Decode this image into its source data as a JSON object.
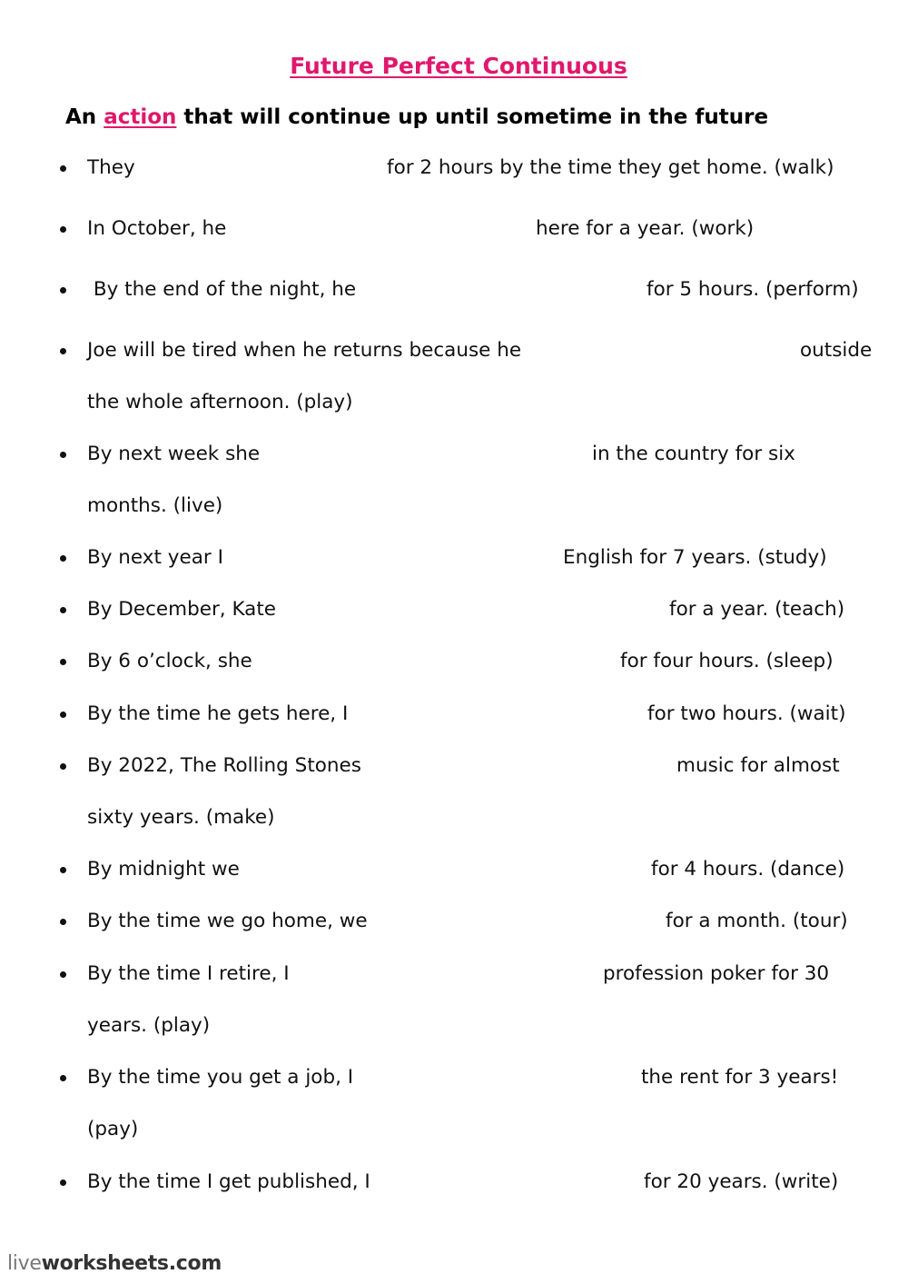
{
  "title": "Future Perfect Continuous",
  "subtitle": {
    "pre": "An ",
    "highlight": "action",
    "post": " that will continue up until sometime in the future"
  },
  "colors": {
    "accent": "#e0186c",
    "text": "#111111"
  },
  "items": [
    {
      "before": "They",
      "after": "for 2 hours by the time they get home. (walk)",
      "cont": ""
    },
    {
      "before": "In October, he",
      "after": "here for a year. (work)",
      "cont": ""
    },
    {
      "before": " By the end of the night, he",
      "after": "for 5 hours. (perform)",
      "cont": ""
    },
    {
      "before": "Joe will be tired when he returns because he",
      "after": "outside",
      "cont": "the whole afternoon. (play)"
    },
    {
      "before": "By next week she",
      "after": "in the country for six",
      "cont": "months. (live)"
    },
    {
      "before": "By next year I",
      "after": "English for 7 years. (study)",
      "cont": ""
    },
    {
      "before": "By December, Kate",
      "after": "for a year. (teach)",
      "cont": ""
    },
    {
      "before": "By 6 o’clock, she",
      "after": "for four hours. (sleep)",
      "cont": ""
    },
    {
      "before": "By the time he gets here, I",
      "after": "for two hours. (wait)",
      "cont": ""
    },
    {
      "before": "By 2022, The Rolling Stones",
      "after": "music for almost",
      "cont": "sixty years. (make)"
    },
    {
      "before": "By midnight we",
      "after": "for 4 hours. (dance)",
      "cont": ""
    },
    {
      "before": "By the time we go home, we",
      "after": "for a month. (tour)",
      "cont": ""
    },
    {
      "before": "By the time I retire, I",
      "after": "profession poker for 30",
      "cont": "years. (play)"
    },
    {
      "before": "By the time you get a job, I",
      "after": "the rent for 3 years!",
      "cont": "(pay)"
    },
    {
      "before": "By the time I get published, I",
      "after": "for 20 years. (write)",
      "cont": ""
    }
  ],
  "answers": [
    "",
    "",
    "",
    "",
    "",
    "",
    "",
    "",
    "",
    "",
    "",
    "",
    "",
    "",
    ""
  ],
  "footer": {
    "light": "live",
    "bold": "worksheets.com"
  }
}
